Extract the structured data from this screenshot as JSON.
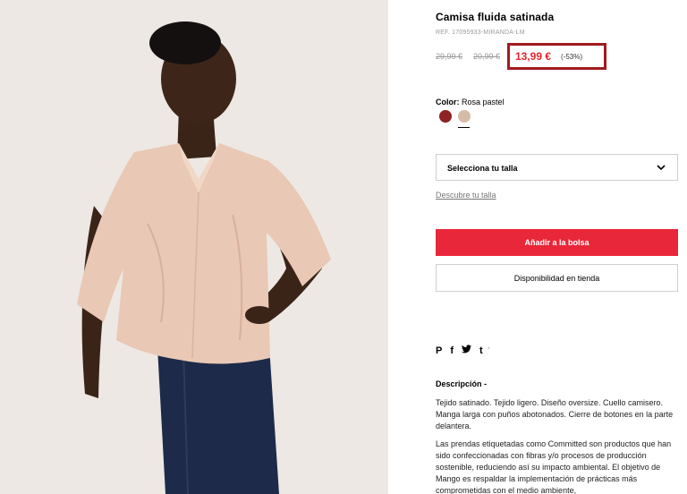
{
  "product": {
    "title": "Camisa fluida satinada",
    "ref": "REF. 17095933-MIRANDA-LM",
    "old_price_1": "29,99 €",
    "old_price_2": "20,99 €",
    "price": "13,99 €",
    "discount": "(-53%)",
    "price_highlight_color": "#a01b1f",
    "price_color": "#e5232b"
  },
  "color": {
    "label": "Color:",
    "selected": "Rosa pastel",
    "swatches": [
      {
        "name": "burgundy",
        "hex": "#8f2224"
      },
      {
        "name": "rosa-pastel",
        "hex": "#d4bca9"
      }
    ]
  },
  "size": {
    "placeholder": "Selecciona tu talla",
    "guide_link": "Descubre tu talla"
  },
  "actions": {
    "add_to_bag": "Añadir a la bolsa",
    "store_availability": "Disponibilidad en tienda",
    "add_color": "#e9273a"
  },
  "share": {
    "icons": [
      "pinterest-icon",
      "facebook-icon",
      "twitter-icon",
      "tumblr-icon"
    ],
    "pinterest": "P",
    "facebook": "f",
    "twitter": "🐦",
    "tumblr": "t",
    "more": "'"
  },
  "description": {
    "title": "Descripción -",
    "paragraph_1": "Tejido satinado. Tejido ligero. Diseño oversize. Cuello camisero. Manga larga con puños abotonados. Cierre de botones en la parte delantera.",
    "paragraph_2": "Las prendas etiquetadas como Committed son productos que han sido confeccionadas con fibras y/o procesos de producción sostenible, reduciendo así su impacto ambiental. El objetivo de Mango es respaldar la implementación de prácticas más comprometidas con el medio ambiente,"
  }
}
